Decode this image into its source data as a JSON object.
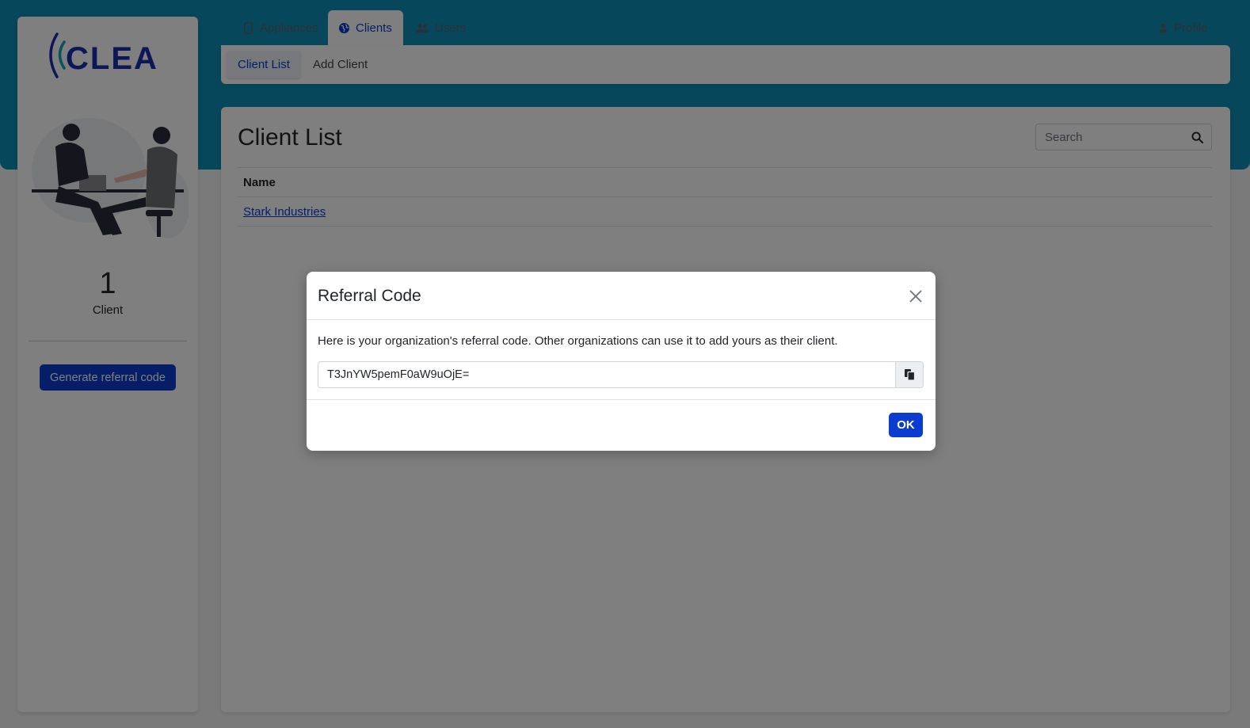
{
  "brand": {
    "logo_text": "CLEA",
    "accent": "#0a3dcf",
    "header_band": "#0e8fb9"
  },
  "sidebar": {
    "illustration": "two-people-handshake-illustration",
    "stat_count": "1",
    "stat_label": "Client",
    "generate_button": "Generate referral code"
  },
  "nav": {
    "tabs": [
      {
        "label": "Appliances",
        "icon": "tablet-icon",
        "active": false
      },
      {
        "label": "Clients",
        "icon": "globe-icon",
        "active": true
      },
      {
        "label": "Users",
        "icon": "users-icon",
        "active": false
      }
    ],
    "profile": {
      "label": "Profile",
      "icon": "user-icon"
    },
    "subtabs": [
      {
        "label": "Client List",
        "active": true
      },
      {
        "label": "Add Client",
        "active": false
      }
    ]
  },
  "main": {
    "title": "Client List",
    "search": {
      "placeholder": "Search",
      "value": ""
    },
    "table": {
      "columns": [
        "Name"
      ],
      "rows": [
        [
          "Stark Industries"
        ]
      ]
    }
  },
  "modal": {
    "title": "Referral Code",
    "description": "Here is your organization's referral code. Other organizations can use it to add yours as their client.",
    "code": "T3JnYW5pemF0aW9uOjE=",
    "ok_label": "OK"
  }
}
